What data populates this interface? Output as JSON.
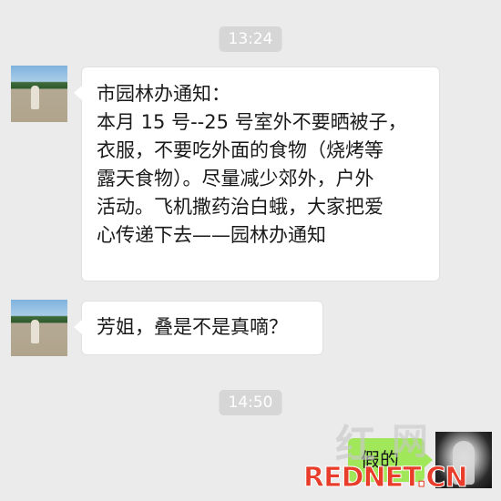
{
  "colors": {
    "background": "#ebebeb",
    "timestamp_bg": "#d6d6d6",
    "received_bubble": "#ffffff",
    "sent_bubble": "#a0e75a",
    "watermark_red": "#e83d2a"
  },
  "timestamps": [
    "13:24",
    "14:50"
  ],
  "messages": [
    {
      "direction": "received",
      "avatar": "avatar-photo",
      "lines": [
        "市园林办通知：",
        "本月 15 号--25 号室外不要晒被子，",
        "衣服，不要吃外面的食物（烧烤等",
        "露天食物）。尽量减少郊外，户外",
        "活动。飞机撒药治白蛾，大家把爱",
        "心传递下去——园林办通知"
      ]
    },
    {
      "direction": "received",
      "avatar": "avatar-photo",
      "lines": [
        "芳姐，叠是不是真嘀？"
      ]
    },
    {
      "direction": "sent",
      "avatar": "avatar-photo-me",
      "text": "假的"
    }
  ],
  "watermark": {
    "hong": "红",
    "wang": "网",
    "red": "RED",
    "net": "NET",
    "dot": ".",
    "cn": "CN"
  }
}
